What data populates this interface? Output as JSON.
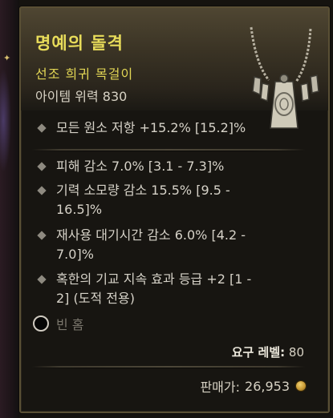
{
  "item": {
    "name": "명예의 돌격",
    "type": "선조 희귀 목걸이",
    "power": "아이템 위력 830",
    "implicit": "모든 원소 저항 +15.2% [15.2]%",
    "affixes": [
      "피해 감소 7.0% [3.1 - 7.3]%",
      "기력 소모량 감소 15.5% [9.5 -\n16.5]%",
      "재사용 대기시간 감소 6.0% [4.2 -\n7.0]%",
      "혹한의 기교 지속 효과 등급 +2 [1 -\n2] (도적 전용)"
    ],
    "socket_label": "빈 홈",
    "required_level_label": "요구 레벨:",
    "required_level_value": "80",
    "sell_label": "판매가:",
    "sell_value": "26,953"
  },
  "icons": {
    "bullet": "diamond-bullet-icon",
    "socket": "empty-socket-icon",
    "coin": "gold-coin-icon",
    "item_image": "amulet-icon"
  },
  "colors": {
    "title": "#e8dc5a",
    "subtitle": "#e2d655",
    "text": "#d6d2c8",
    "muted": "#7b776d",
    "border": "#5a5035"
  }
}
